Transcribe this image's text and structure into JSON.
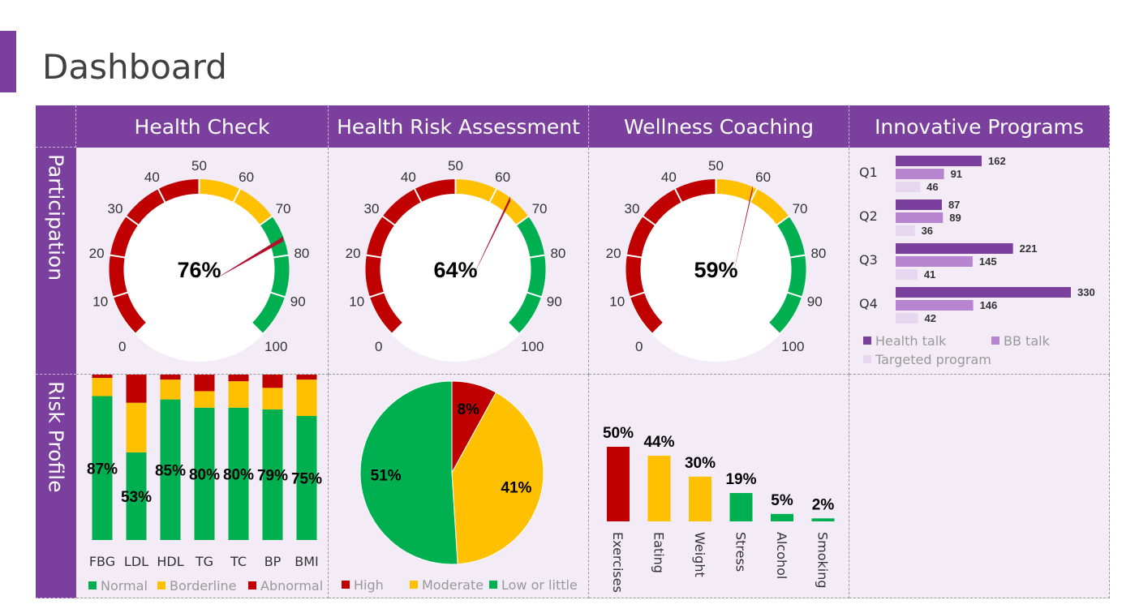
{
  "page": {
    "title": "Dashboard"
  },
  "columns": [
    "Health Check",
    "Health Risk Assessment",
    "Wellness Coaching",
    "Innovative Programs"
  ],
  "rows": [
    "Participation",
    "Risk Profile"
  ],
  "colors": {
    "purple": "#7b3f9e",
    "red": "#c00000",
    "yellow": "#ffc000",
    "green": "#00b050",
    "bb_talk": "#b784d0",
    "targeted": "#e7d6ef"
  },
  "gauges": {
    "ticks": [
      "0",
      "10",
      "20",
      "30",
      "40",
      "50",
      "60",
      "70",
      "80",
      "90",
      "100"
    ],
    "items": [
      {
        "label": "76%",
        "value": 76
      },
      {
        "label": "64%",
        "value": 64
      },
      {
        "label": "59%",
        "value": 59
      }
    ]
  },
  "chart_data": [
    {
      "type": "bar",
      "orientation": "horizontal",
      "categories": [
        "Q1",
        "Q2",
        "Q3",
        "Q4"
      ],
      "series": [
        {
          "name": "Health talk",
          "values": [
            162,
            87,
            221,
            330
          ]
        },
        {
          "name": "BB talk",
          "values": [
            91,
            89,
            145,
            146
          ]
        },
        {
          "name": "Targeted program",
          "values": [
            46,
            36,
            41,
            42
          ]
        }
      ]
    },
    {
      "type": "bar",
      "stacked": true,
      "categories": [
        "FBG",
        "LDL",
        "HDL",
        "TG",
        "TC",
        "BP",
        "BMI"
      ],
      "series": [
        {
          "name": "Normal",
          "values": [
            87,
            53,
            85,
            80,
            80,
            79,
            75
          ]
        },
        {
          "name": "Borderline",
          "values": [
            11,
            30,
            12,
            10,
            16,
            13,
            22
          ]
        },
        {
          "name": "Abnormal",
          "values": [
            2,
            17,
            3,
            10,
            4,
            8,
            3
          ]
        }
      ],
      "data_labels": [
        "87%",
        "53%",
        "85%",
        "80%",
        "80%",
        "79%",
        "75%"
      ],
      "ylim": [
        0,
        100
      ]
    },
    {
      "type": "pie",
      "slices": [
        {
          "name": "High",
          "value": 8,
          "label": "8%"
        },
        {
          "name": "Moderate",
          "value": 41,
          "label": "41%"
        },
        {
          "name": "Low or little",
          "value": 51,
          "label": "51%"
        }
      ]
    },
    {
      "type": "bar",
      "categories": [
        "Exercises",
        "Eating",
        "Weight",
        "Stress",
        "Alcohol",
        "Smoking"
      ],
      "values": [
        50,
        44,
        30,
        19,
        5,
        2
      ],
      "data_labels": [
        "50%",
        "44%",
        "30%",
        "19%",
        "5%",
        "2%"
      ],
      "bar_colors": [
        "red",
        "yellow",
        "yellow",
        "green",
        "green",
        "green"
      ]
    }
  ]
}
